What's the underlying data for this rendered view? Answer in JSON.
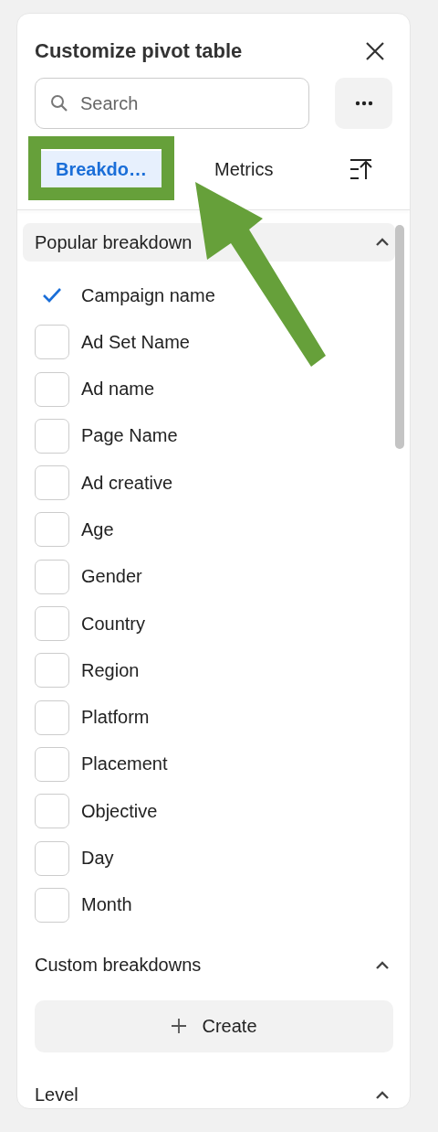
{
  "panel": {
    "title": "Customize pivot table"
  },
  "search": {
    "placeholder": "Search"
  },
  "tabs": [
    {
      "label": "Breakdo…",
      "selected": true
    },
    {
      "label": "Metrics",
      "selected": false
    }
  ],
  "sections": [
    {
      "title": "Popular breakdown",
      "expanded": true,
      "highlighted": true,
      "items": [
        {
          "label": "Campaign name",
          "checked": true
        },
        {
          "label": "Ad Set Name",
          "checked": false
        },
        {
          "label": "Ad name",
          "checked": false
        },
        {
          "label": "Page Name",
          "checked": false
        },
        {
          "label": "Ad creative",
          "checked": false
        },
        {
          "label": "Age",
          "checked": false
        },
        {
          "label": "Gender",
          "checked": false
        },
        {
          "label": "Country",
          "checked": false
        },
        {
          "label": "Region",
          "checked": false
        },
        {
          "label": "Platform",
          "checked": false
        },
        {
          "label": "Placement",
          "checked": false
        },
        {
          "label": "Objective",
          "checked": false
        },
        {
          "label": "Day",
          "checked": false
        },
        {
          "label": "Month",
          "checked": false
        }
      ]
    },
    {
      "title": "Custom breakdowns",
      "expanded": true,
      "highlighted": false,
      "button": "Create"
    },
    {
      "title": "Level",
      "expanded": true,
      "highlighted": false
    }
  ]
}
